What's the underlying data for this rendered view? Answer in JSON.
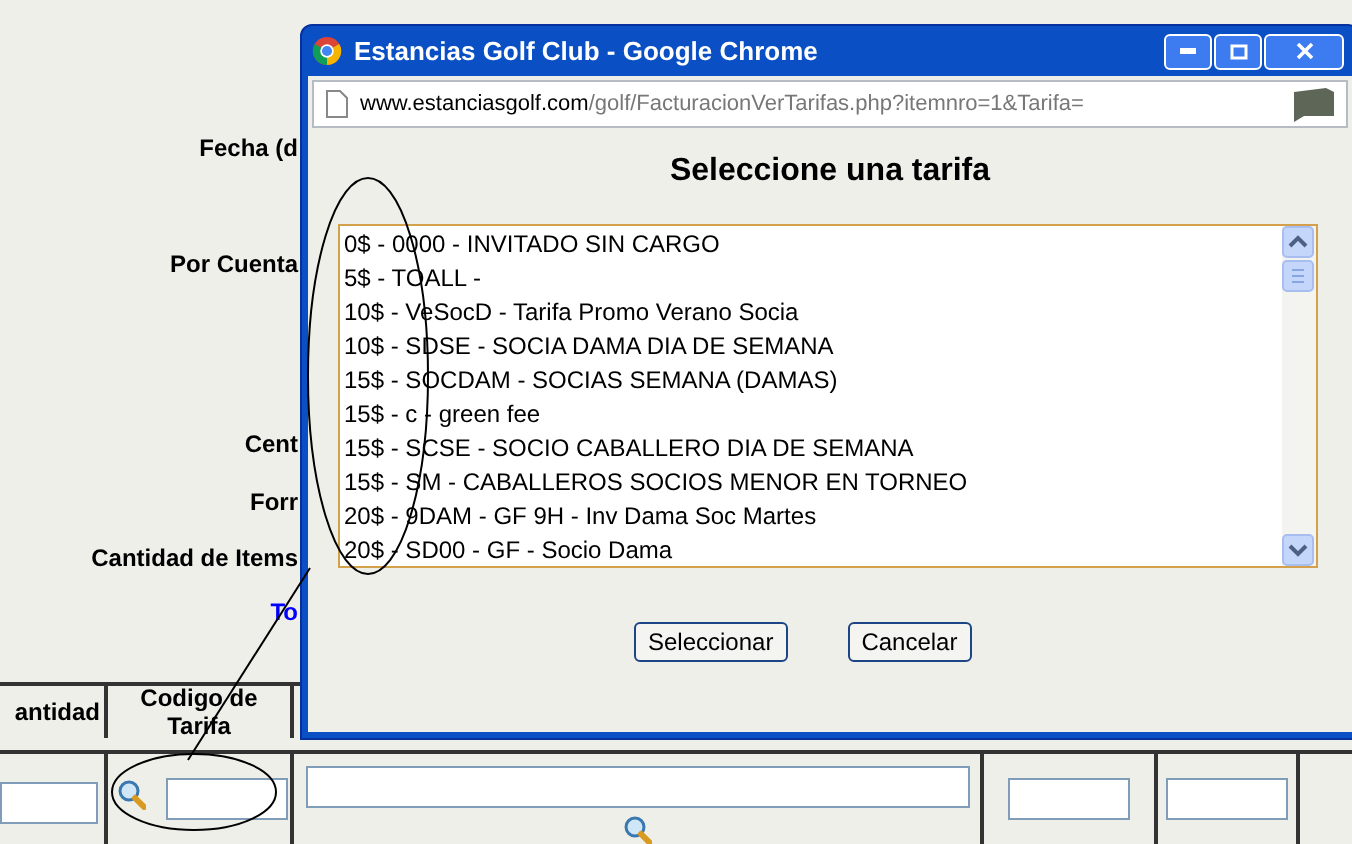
{
  "background_form": {
    "labels": [
      {
        "text": "Fecha (d",
        "kind": "label"
      },
      {
        "text": "Por Cuenta",
        "kind": "label"
      },
      {
        "text": "Cent",
        "kind": "label"
      },
      {
        "text": "Forr",
        "kind": "label"
      },
      {
        "text": "Cantidad de Items",
        "kind": "label"
      },
      {
        "text": "To",
        "kind": "link"
      }
    ],
    "table": {
      "columns": [
        "antidad",
        "Codigo de Tarifa"
      ]
    }
  },
  "popup": {
    "title": "Estancias Golf Club - Google Chrome",
    "url_host": "www.estanciasgolf.com",
    "url_path": "/golf/FacturacionVerTarifas.php?itemnro=1&Tarifa=",
    "heading": "Seleccione una tarifa",
    "options": [
      {
        "text": "0$ - 0000 - INVITADO SIN CARGO",
        "selected": false
      },
      {
        "text": "5$ - TOALL -",
        "selected": false
      },
      {
        "text": "10$ - VeSocD - Tarifa Promo Verano Socia",
        "selected": false
      },
      {
        "text": "10$ - SDSE - SOCIA DAMA DIA DE SEMANA",
        "selected": false
      },
      {
        "text": "15$ - SOCDAM - SOCIAS SEMANA (DAMAS)",
        "selected": false
      },
      {
        "text": "15$ - c - green fee",
        "selected": false
      },
      {
        "text": "15$ - SCSE - SOCIO CABALLERO DIA DE SEMANA",
        "selected": false
      },
      {
        "text": "15$ - SM - CABALLEROS SOCIOS MENOR EN TORNEO",
        "selected": false
      },
      {
        "text": "20$ - 9DAM - GF 9H - Inv Dama Soc Martes",
        "selected": false
      },
      {
        "text": "20$ - SD00 - GF - Socio Dama",
        "selected": false
      }
    ],
    "buttons": [
      "Seleccionar",
      "Cancelar"
    ]
  }
}
